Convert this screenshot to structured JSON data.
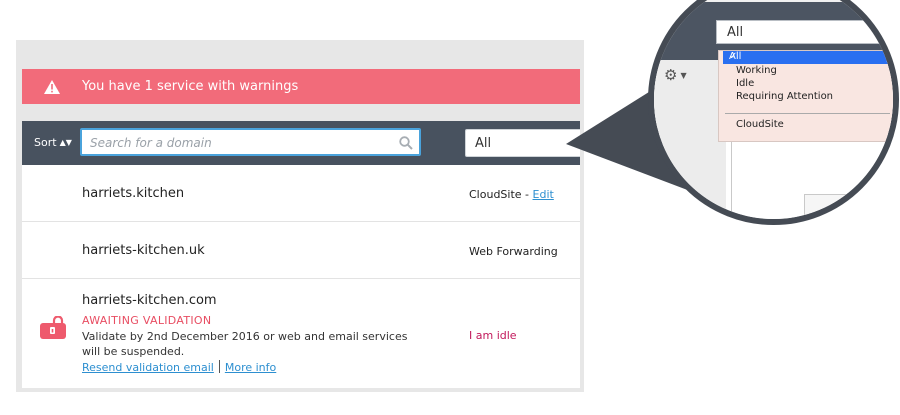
{
  "warning": {
    "text": "You have 1 service with warnings",
    "icon": "warning-triangle-icon"
  },
  "toolbar": {
    "sort_label": "Sort",
    "search_placeholder": "Search for a domain",
    "filter_value": "All"
  },
  "domains": [
    {
      "name": "harriets.kitchen",
      "service": "CloudSite - ",
      "service_link": "Edit"
    },
    {
      "name": "harriets-kitchen.uk",
      "service": "Web Forwarding"
    },
    {
      "name": "harriets-kitchen.com",
      "status": "AWAITING VALIDATION",
      "message": "Validate by 2nd December 2016 or web and email services will be suspended.",
      "link1": "Resend validation email",
      "link2": "More info",
      "service": "I am idle",
      "icon": "unlocked-padlock-icon"
    }
  ],
  "magnifier": {
    "select_value": "All",
    "options": [
      "All",
      "Working",
      "Idle",
      "Requiring Attention",
      "CloudSite"
    ],
    "selected_index": 0,
    "checkmark": "✓"
  },
  "colors": {
    "warning": "#f26b7a",
    "toolbar": "#48525f",
    "accent": "#2d8fd0",
    "alert": "#e84d62"
  }
}
